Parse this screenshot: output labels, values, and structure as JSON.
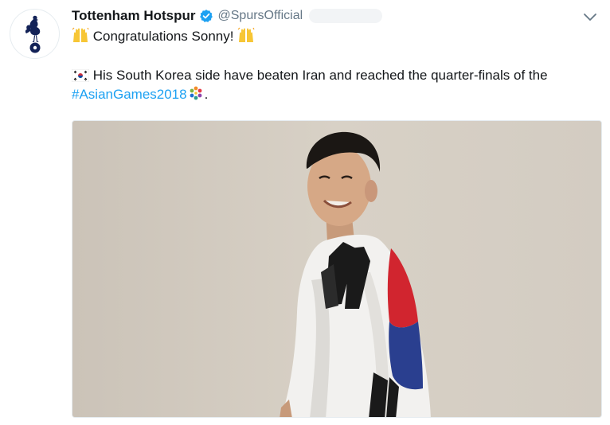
{
  "tweet": {
    "author_name": "Tottenham Hotspur",
    "handle": "@SpursOfficial",
    "line1_prefix_emoji": "raised-hands",
    "line1_text": "Congratulations Sonny!",
    "line1_suffix_emoji": "raised-hands",
    "line2_flag_emoji": "south-korea-flag",
    "line2_text": "His South Korea side have beaten Iran and reached the quarter-finals of the",
    "hashtag": "#AsianGames2018",
    "line2_end": "."
  },
  "icons": {
    "avatar": "spurs-cockerel-logo",
    "verified": "verified-badge-icon",
    "more": "chevron-down-icon"
  },
  "colors": {
    "hashtag": "#1da1f2",
    "verified": "#1da1f2",
    "handle": "#657786"
  }
}
